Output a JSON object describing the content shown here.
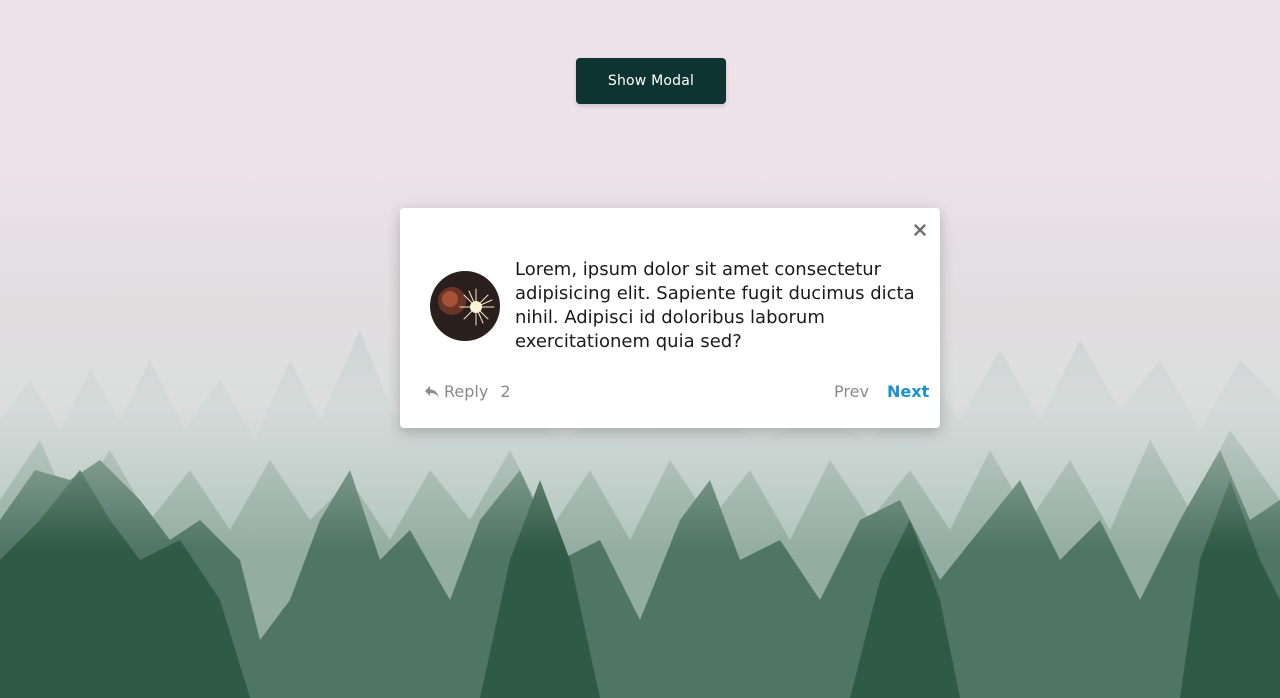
{
  "page": {
    "show_modal_label": "Show Modal"
  },
  "modal": {
    "message": "Lorem, ipsum dolor sit amet consectetur adipisicing elit. Sapiente fugit ducimus dicta nihil. Adipisci id doloribus laborum exercitationem quia sed?",
    "reply_label": "Reply",
    "reply_count": "2",
    "prev_label": "Prev",
    "next_label": "Next",
    "close_icon": "close-icon",
    "reply_icon": "reply-icon"
  },
  "colors": {
    "button_bg": "#0d3431",
    "next_link": "#1a8fd6",
    "muted_text": "#8a8a8a"
  }
}
